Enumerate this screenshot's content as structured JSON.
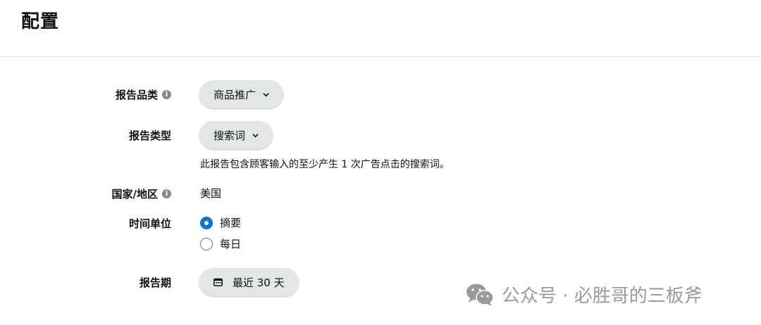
{
  "page": {
    "title": "配置"
  },
  "fields": {
    "category": {
      "label": "报告品类",
      "value": "商品推广"
    },
    "type": {
      "label": "报告类型",
      "value": "搜索词",
      "description": "此报告包含顾客输入的至少产生 1 次广告点击的搜索词。"
    },
    "country": {
      "label": "国家/地区",
      "value": "美国"
    },
    "time_unit": {
      "label": "时间单位",
      "options": [
        "摘要",
        "每日"
      ],
      "selected": "摘要"
    },
    "period": {
      "label": "报告期",
      "value": "最近 30 天"
    }
  },
  "icons": {
    "info": "info-icon",
    "chevron": "chevron-down-icon",
    "calendar": "calendar-icon",
    "wechat": "wechat-icon"
  },
  "colors": {
    "accent": "#0972d3",
    "pill_bg": "#e3e6e6"
  },
  "watermark": {
    "text": "公众号 · 必胜哥的三板斧"
  }
}
